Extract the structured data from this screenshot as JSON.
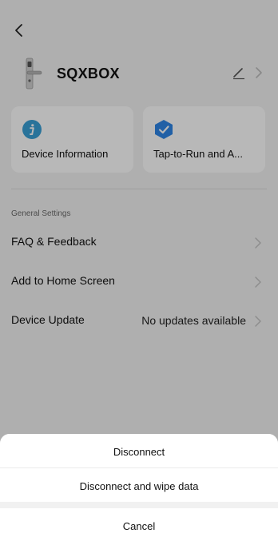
{
  "header": {
    "device_name": "SQXBOX"
  },
  "cards": [
    {
      "label": "Device Information",
      "icon": "info-icon",
      "color": "#3aa0d6"
    },
    {
      "label": "Tap-to-Run and A...",
      "icon": "check-badge-icon",
      "color": "#2f86e6"
    }
  ],
  "settings": {
    "section_title": "General Settings",
    "rows": [
      {
        "label": "FAQ & Feedback",
        "value": ""
      },
      {
        "label": "Add to Home Screen",
        "value": ""
      },
      {
        "label": "Device Update",
        "value": "No updates available"
      }
    ]
  },
  "action_sheet": {
    "disconnect": "Disconnect",
    "disconnect_wipe": "Disconnect and wipe data",
    "cancel": "Cancel"
  }
}
